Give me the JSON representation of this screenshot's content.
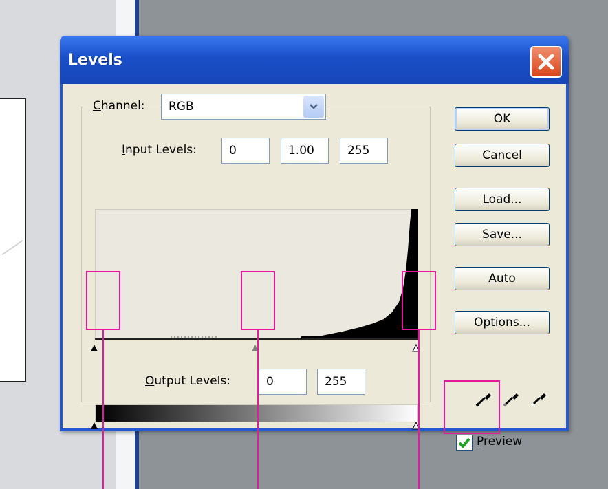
{
  "dialog": {
    "title": "Levels",
    "close_icon": "close-icon"
  },
  "channel": {
    "label_prefix": "",
    "label_accel": "C",
    "label_rest": "hannel:",
    "value": "RGB"
  },
  "input_levels": {
    "label_accel": "I",
    "label_rest": "nput Levels:",
    "black": "0",
    "gamma": "1.00",
    "white": "255"
  },
  "output_levels": {
    "label_accel": "O",
    "label_rest": "utput Levels:",
    "black": "0",
    "white": "255"
  },
  "buttons": {
    "ok": "OK",
    "cancel": "Cancel",
    "load_accel": "L",
    "load_rest": "oad...",
    "save_accel": "S",
    "save_rest": "ave...",
    "auto_accel": "A",
    "auto_rest": "uto",
    "options_prefix": "Opt",
    "options_accel": "i",
    "options_rest": "ons..."
  },
  "preview": {
    "checked": true,
    "label_accel": "P",
    "label_rest": "review"
  },
  "icons": {
    "black_eyedropper": "eyedropper-black-icon",
    "gray_eyedropper": "eyedropper-gray-icon",
    "white_eyedropper": "eyedropper-white-icon"
  },
  "colors": {
    "title_bar": "#2458d3",
    "dialog_face": "#ece9d8",
    "callout": "#e6199c",
    "check": "#21a121"
  }
}
